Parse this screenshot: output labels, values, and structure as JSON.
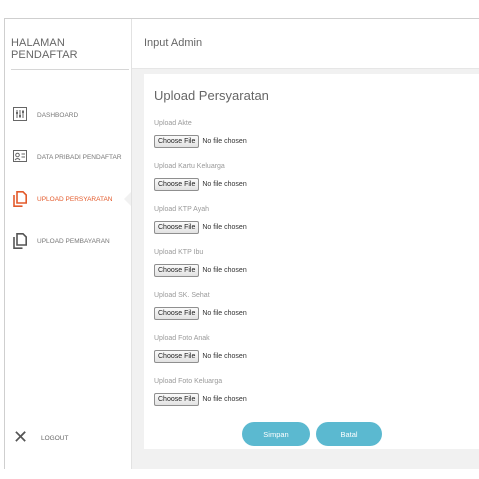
{
  "sidebar": {
    "brand": "HALAMAN PENDAFTAR",
    "items": [
      {
        "label": "DASHBOARD",
        "icon": "dashboard-icon",
        "active": false
      },
      {
        "label": "DATA PRIBADI PENDAFTAR",
        "icon": "id-card-icon",
        "active": false
      },
      {
        "label": "UPLOAD PERSYARATAN",
        "icon": "documents-icon",
        "active": true
      },
      {
        "label": "UPLOAD PEMBAYARAN",
        "icon": "documents-icon",
        "active": false
      }
    ],
    "logout": "LOGOUT"
  },
  "header": {
    "title": "Input Admin"
  },
  "form": {
    "title": "Upload Persyaratan",
    "choose_label": "Choose File",
    "no_file": "No file chosen",
    "fields": [
      {
        "label": "Upload Akte"
      },
      {
        "label": "Upload Kartu Keluarga"
      },
      {
        "label": "Upload KTP Ayah"
      },
      {
        "label": "Upload KTP Ibu"
      },
      {
        "label": "Upload SK. Sehat"
      },
      {
        "label": "Upload Foto Anak"
      },
      {
        "label": "Upload Foto Keluarga"
      }
    ],
    "save_label": "Simpan",
    "cancel_label": "Batal"
  },
  "colors": {
    "accent": "#e35a2b",
    "button": "#5bb9d0",
    "background": "#f1f1f1"
  }
}
